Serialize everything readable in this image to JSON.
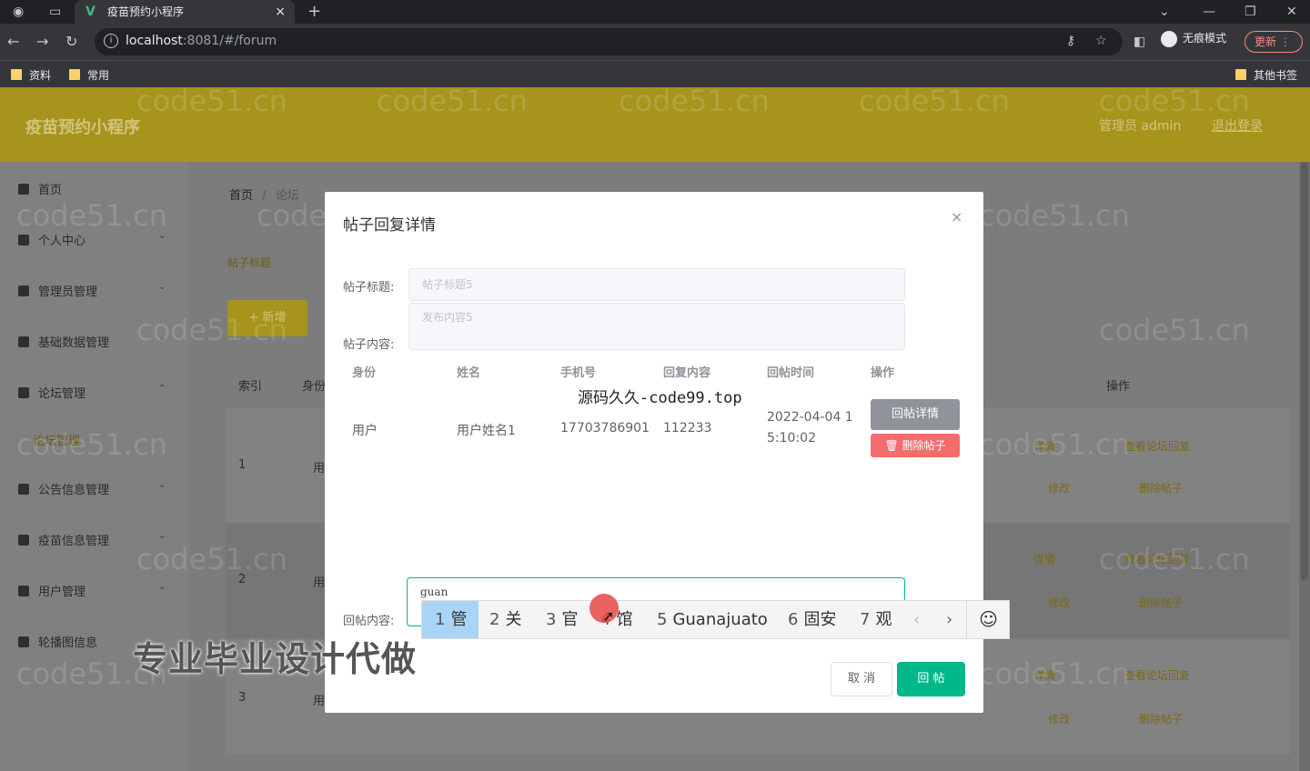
{
  "browser": {
    "tab_title": "疫苗预约小程序",
    "tab_close": "×",
    "new_tab": "+",
    "url_host": "localhost",
    "url_rest": ":8081/#/forum",
    "incognito": "无痕模式",
    "update": "更新",
    "bookmarks": [
      "资料",
      "常用"
    ],
    "other_bookmarks": "其他书签"
  },
  "app": {
    "title": "疫苗预约小程序",
    "user": "管理员 admin",
    "logout": "退出登录",
    "accent_color": "#a7941c"
  },
  "sidebar": {
    "items": [
      {
        "label": "首页"
      },
      {
        "label": "个人中心"
      },
      {
        "label": "管理员管理"
      },
      {
        "label": "基础数据管理"
      },
      {
        "label": "论坛管理"
      },
      {
        "label": "公告信息管理"
      },
      {
        "label": "疫苗信息管理"
      },
      {
        "label": "用户管理"
      },
      {
        "label": "轮播图信息"
      }
    ],
    "active_sub": "论坛管理"
  },
  "main": {
    "breadcrumb": [
      "首页",
      "论坛"
    ],
    "search_label": "帖子标题",
    "add_button": "+ 新增",
    "table_headers": [
      "索引",
      "身份",
      "操作"
    ],
    "rows": [
      {
        "index": "1",
        "identity": "用"
      },
      {
        "index": "2",
        "identity": "用"
      },
      {
        "index": "3",
        "identity": "用"
      }
    ],
    "row_actions": [
      "详情",
      "查看论坛回复",
      "修改",
      "删除帖子"
    ]
  },
  "dialog": {
    "title": "帖子回复详情",
    "close": "×",
    "post_title_label": "帖子标题:",
    "post_title_value": "帖子标题5",
    "post_content_label": "帖子内容:",
    "post_content_value": "发布内容5",
    "table": {
      "headers": [
        "身份",
        "姓名",
        "手机号",
        "回复内容",
        "回帖时间",
        "操作"
      ],
      "row": {
        "identity": "用户",
        "name": "用户姓名1",
        "phone": "17703786901",
        "content": "112233",
        "time_line1": "2022-04-04 1",
        "time_line2": "5:10:02"
      },
      "detail_button": "回帖详情",
      "delete_button": "删除帖子"
    },
    "reply_label": "回帖内容:",
    "reply_value": "guan",
    "cancel_button": "取 消",
    "reply_button": "回 帖"
  },
  "ime": {
    "candidates": [
      {
        "n": "1",
        "text": "管"
      },
      {
        "n": "2",
        "text": "关"
      },
      {
        "n": "3",
        "text": "官"
      },
      {
        "n": "4",
        "text": "馆"
      },
      {
        "n": "5",
        "text": "Guanajuato"
      },
      {
        "n": "6",
        "text": "固安"
      },
      {
        "n": "7",
        "text": "观"
      }
    ],
    "prev": "‹",
    "next": "›",
    "emoji": "☺"
  },
  "overlays": {
    "source_text": "源码久久-code99.top",
    "promo_text": "专业毕业设计代做",
    "watermark": "code51.cn"
  }
}
